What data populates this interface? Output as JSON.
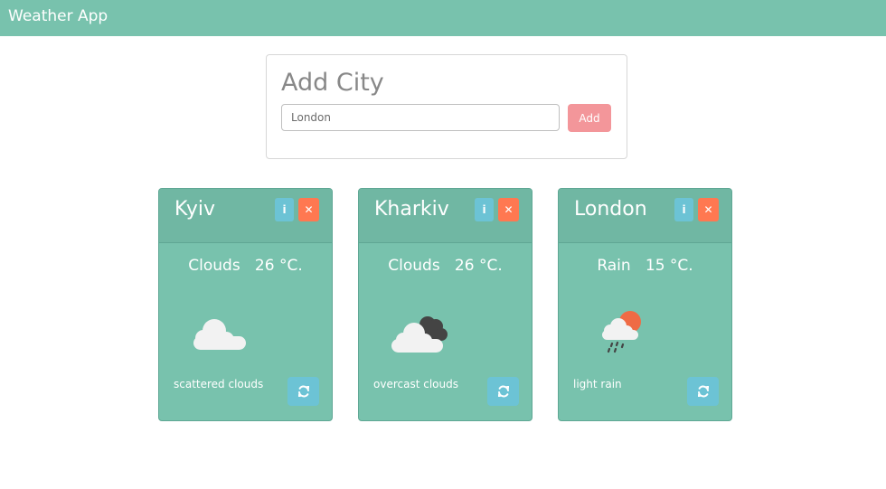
{
  "app": {
    "title": "Weather App"
  },
  "add_city": {
    "heading": "Add City",
    "input_placeholder": "London",
    "button_label": "Add"
  },
  "colors": {
    "primary": "#78c2ad",
    "secondary": "#f3969a",
    "info": "#6cc3d5",
    "danger": "#ff7851"
  },
  "cities": [
    {
      "name": "Kyiv",
      "summary": "Clouds   26 °C.",
      "description": "scattered clouds",
      "icon": "scattered-clouds-icon",
      "info_glyph": "i",
      "delete_glyph": "✕"
    },
    {
      "name": "Kharkiv",
      "summary": "Clouds   26 °C.",
      "description": "overcast clouds",
      "icon": "overcast-clouds-icon",
      "info_glyph": "i",
      "delete_glyph": "✕"
    },
    {
      "name": "London",
      "summary": "Rain   15 °C.",
      "description": "light rain",
      "icon": "light-rain-icon",
      "info_glyph": "i",
      "delete_glyph": "✕"
    }
  ]
}
